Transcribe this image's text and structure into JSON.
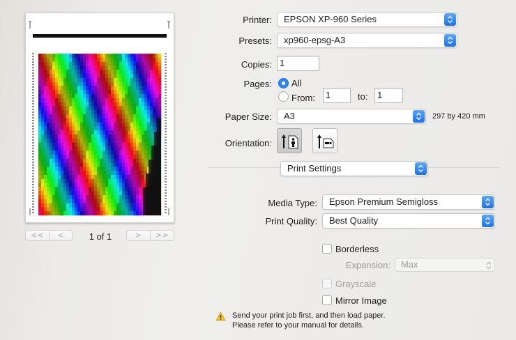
{
  "preview": {
    "pager": {
      "first": "<<",
      "prev": "<",
      "next": ">",
      "last": ">>"
    },
    "page_indicator": "1 of 1"
  },
  "printer": {
    "label": "Printer:",
    "value": "EPSON XP-960 Series"
  },
  "presets": {
    "label": "Presets:",
    "value": "xp960-epsg-A3"
  },
  "copies": {
    "label": "Copies:",
    "value": "1"
  },
  "pages": {
    "label": "Pages:",
    "all_label": "All",
    "from_label": "From:",
    "from_value": "1",
    "to_label": "to:",
    "to_value": "1",
    "selected": "All"
  },
  "paper_size": {
    "label": "Paper Size:",
    "value": "A3",
    "dimensions": "297 by 420 mm"
  },
  "orientation": {
    "label": "Orientation:",
    "selected": "portrait"
  },
  "section_popup": {
    "value": "Print Settings"
  },
  "media_type": {
    "label": "Media Type:",
    "value": "Epson Premium Semigloss"
  },
  "print_quality": {
    "label": "Print Quality:",
    "value": "Best Quality"
  },
  "borderless": {
    "label": "Borderless",
    "checked": false
  },
  "expansion": {
    "label": "Expansion:",
    "value": "Max",
    "enabled": false
  },
  "grayscale": {
    "label": "Grayscale",
    "checked": false,
    "enabled": false
  },
  "mirror_image": {
    "label": "Mirror Image",
    "checked": false
  },
  "notice": {
    "line1": "Send your print job first, and then load paper.",
    "line2": "Please refer to your manual for details."
  },
  "colors": {
    "accent": "#2f86f7",
    "chevron_top": "#5ba8fd",
    "chevron_bottom": "#1a6ff3",
    "warning": "#f4c430"
  }
}
